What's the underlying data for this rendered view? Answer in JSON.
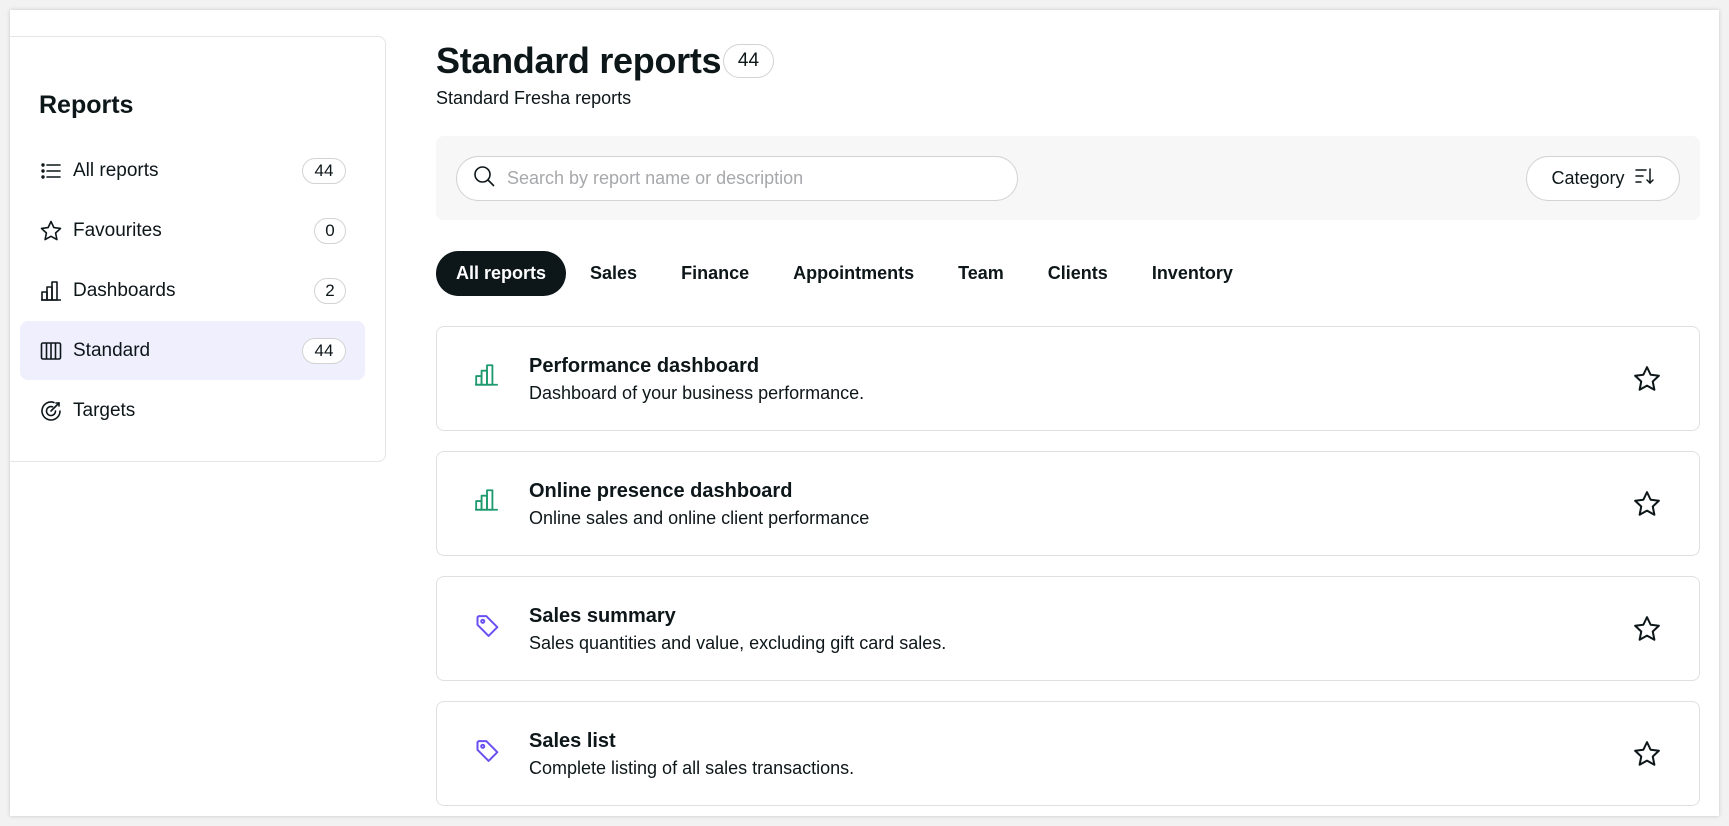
{
  "sidebar": {
    "title": "Reports",
    "items": [
      {
        "label": "All reports",
        "count": "44"
      },
      {
        "label": "Favourites",
        "count": "0"
      },
      {
        "label": "Dashboards",
        "count": "2"
      },
      {
        "label": "Standard",
        "count": "44"
      },
      {
        "label": "Targets"
      }
    ],
    "active_bg": "#efeffd"
  },
  "header": {
    "title": "Standard reports",
    "count": "44",
    "subtitle": "Standard Fresha reports"
  },
  "toolbar": {
    "search_placeholder": "Search by report name or description",
    "search_value": "",
    "category_label": "Category"
  },
  "tabs": [
    "All reports",
    "Sales",
    "Finance",
    "Appointments",
    "Team",
    "Clients",
    "Inventory"
  ],
  "reports": [
    {
      "title": "Performance dashboard",
      "description": "Dashboard of your business performance.",
      "icon": "bar-chart-icon",
      "icon_color": "#1f9a6f"
    },
    {
      "title": "Online presence dashboard",
      "description": "Online sales and online client performance",
      "icon": "bar-chart-icon",
      "icon_color": "#1f9a6f"
    },
    {
      "title": "Sales summary",
      "description": "Sales quantities and value, excluding gift card sales.",
      "icon": "tag-icon",
      "icon_color": "#6950f3"
    },
    {
      "title": "Sales list",
      "description": "Complete listing of all sales transactions.",
      "icon": "tag-icon",
      "icon_color": "#6950f3"
    }
  ],
  "colors": {
    "primary_text": "#0d1619",
    "active_tab_bg": "#0d1619",
    "toolbar_bg": "#f7f7f8"
  }
}
